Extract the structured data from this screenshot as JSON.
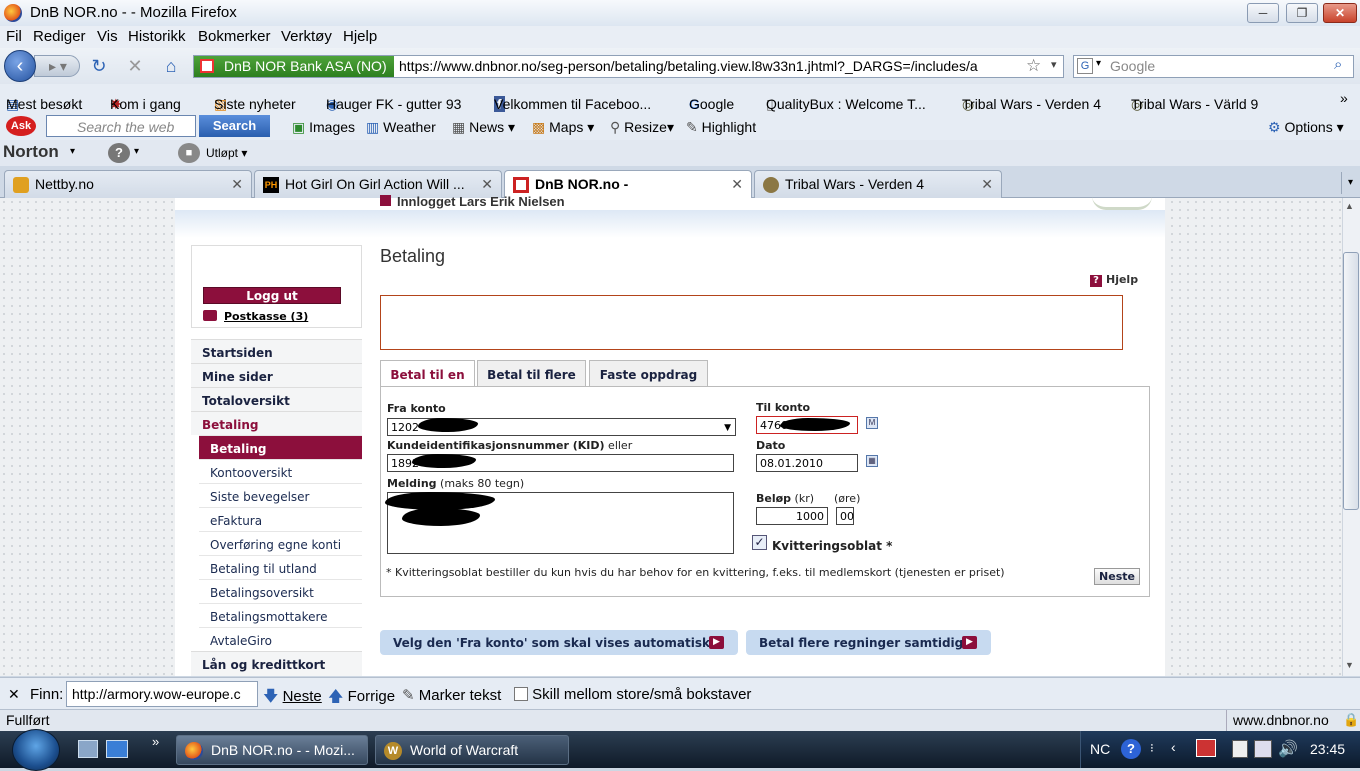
{
  "window": {
    "title": "DnB NOR.no - - Mozilla Firefox",
    "min": "─",
    "max": "❐",
    "close": "✕"
  },
  "menu": [
    "Fil",
    "Rediger",
    "Vis",
    "Historikk",
    "Bokmerker",
    "Verktøy",
    "Hjelp"
  ],
  "nav": {
    "site_identity": "DnB NOR Bank ASA (NO)",
    "url": "https://www.dnbnor.no/seg-person/betaling/betaling.view.l8w33n1.jhtml?_DARGS=/includes/a",
    "search_placeholder": "Google"
  },
  "bookmarks": [
    "Mest besøkt",
    "Kom i gang",
    "Siste nyheter",
    "Hauger FK - gutter 93",
    "Velkommen til Faceboo...",
    "Google",
    "QualityBux : Welcome T...",
    "Tribal Wars - Verden 4",
    "Tribal Wars - Värld 9"
  ],
  "askbar": {
    "search_placeholder": "Search the web",
    "search_button": "Search",
    "items": [
      "Images",
      "Weather",
      "News",
      "Maps",
      "Resize",
      "Highlight"
    ],
    "options": "Options"
  },
  "norton": {
    "logo": "Norton",
    "status": "Utløpt"
  },
  "tabs": [
    {
      "label": "Nettby.no",
      "active": false
    },
    {
      "label": "Hot Girl On Girl Action Will ...",
      "active": false
    },
    {
      "label": "DnB NOR.no -",
      "active": true
    },
    {
      "label": "Tribal Wars - Verden 4",
      "active": false
    }
  ],
  "page": {
    "logged_in": "Innlogget Lars Erik Nielsen",
    "logout": "Logg ut",
    "postkasse": "Postkasse (3)",
    "nav_main": [
      "Startsiden",
      "Mine sider",
      "Totaloversikt",
      "Betaling"
    ],
    "nav_sub": [
      "Betaling",
      "Kontooversikt",
      "Siste bevegelser",
      "eFaktura",
      "Overføring egne konti",
      "Betaling til utland",
      "Betalingsoversikt",
      "Betalingsmottakere",
      "AvtaleGiro"
    ],
    "nav_bottom": "Lån og kredittkort",
    "heading": "Betaling",
    "help": "Hjelp",
    "form_tabs": [
      "Betal til en",
      "Betal til flere",
      "Faste oppdrag"
    ],
    "fra_konto_label": "Fra konto",
    "fra_konto_value": "1202",
    "til_konto_label": "Til konto",
    "til_konto_value": "4760",
    "kid_label": "Kundeidentifikasjonsnummer (KID)",
    "kid_or": "eller",
    "kid_value": "1892",
    "dato_label": "Dato",
    "dato_value": "08.01.2010",
    "melding_label": "Melding",
    "melding_hint": "(maks 80 tegn)",
    "belop_label": "Beløp",
    "belop_kr": "(kr)",
    "belop_ore_label": "(øre)",
    "belop_value": "1000",
    "ore_value": "00",
    "kvittering_label": "Kvitteringsoblat *",
    "footnote": "* Kvitteringsoblat bestiller du kun hvis du har behov for en kvittering, f.eks. til medlemskort (tjenesten er priset)",
    "neste": "Neste",
    "link1": "Velg den 'Fra konto' som skal vises automatisk",
    "link2": "Betal flere regninger samtidig"
  },
  "findbar": {
    "label": "Finn:",
    "value": "http://armory.wow-europe.c",
    "next": "Neste",
    "prev": "Forrige",
    "highlight": "Marker tekst",
    "match_case": "Skill mellom store/små bokstaver"
  },
  "status": {
    "text": "Fullført",
    "host": "www.dnbnor.no"
  },
  "taskbar": {
    "tasks": [
      "DnB NOR.no - - Mozi...",
      "World of Warcraft"
    ],
    "lang": "NC",
    "time": "23:45"
  },
  "colors": {
    "brand": "#8c0f3c",
    "link_blue": "#c7daf0"
  }
}
